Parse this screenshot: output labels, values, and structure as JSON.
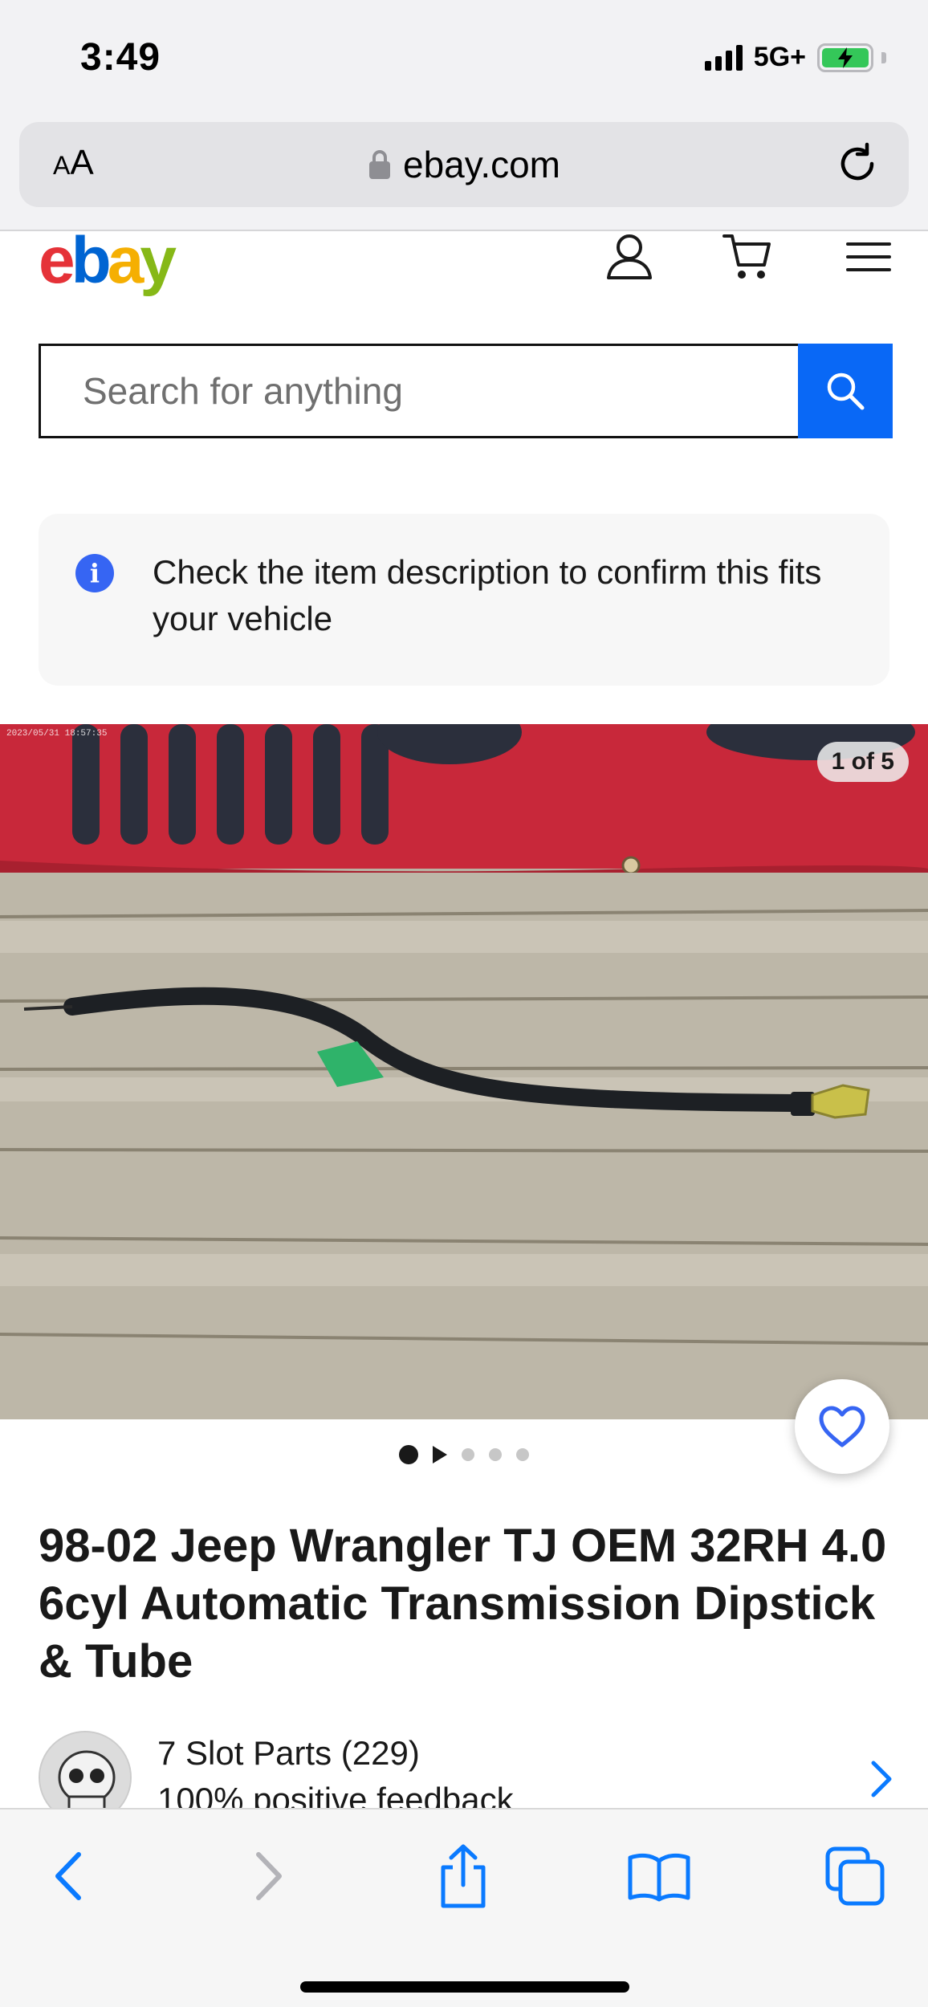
{
  "status_bar": {
    "time": "3:49",
    "network": "5G+",
    "battery_state": "charging"
  },
  "browser": {
    "text_size_label_small": "A",
    "text_size_label_large": "A",
    "url": "ebay.com"
  },
  "header": {
    "logo_letters": [
      "e",
      "b",
      "a",
      "y"
    ],
    "icons": [
      "user-icon",
      "cart-icon",
      "menu-icon"
    ]
  },
  "search": {
    "placeholder": "Search for anything"
  },
  "notice": {
    "icon": "i",
    "text": "Check the item description to confirm this fits your vehicle"
  },
  "gallery": {
    "counter": "1 of 5",
    "image_count": 5,
    "current_index": 1
  },
  "item": {
    "title": "98-02 Jeep Wrangler TJ OEM 32RH 4.0 6cyl Automatic Transmission Dipstick & Tube"
  },
  "seller": {
    "name": "7 Slot Parts (229)",
    "feedback": "100% positive feedback"
  },
  "toolbar": {
    "icons": [
      "back-icon",
      "forward-icon",
      "share-icon",
      "bookmarks-icon",
      "tabs-icon"
    ]
  },
  "colors": {
    "ebay_red": "#e53238",
    "ebay_blue": "#0064d2",
    "ebay_yellow": "#f5af02",
    "ebay_green": "#86b817",
    "search_button": "#0968f6",
    "ios_blue": "#0a7aff"
  }
}
